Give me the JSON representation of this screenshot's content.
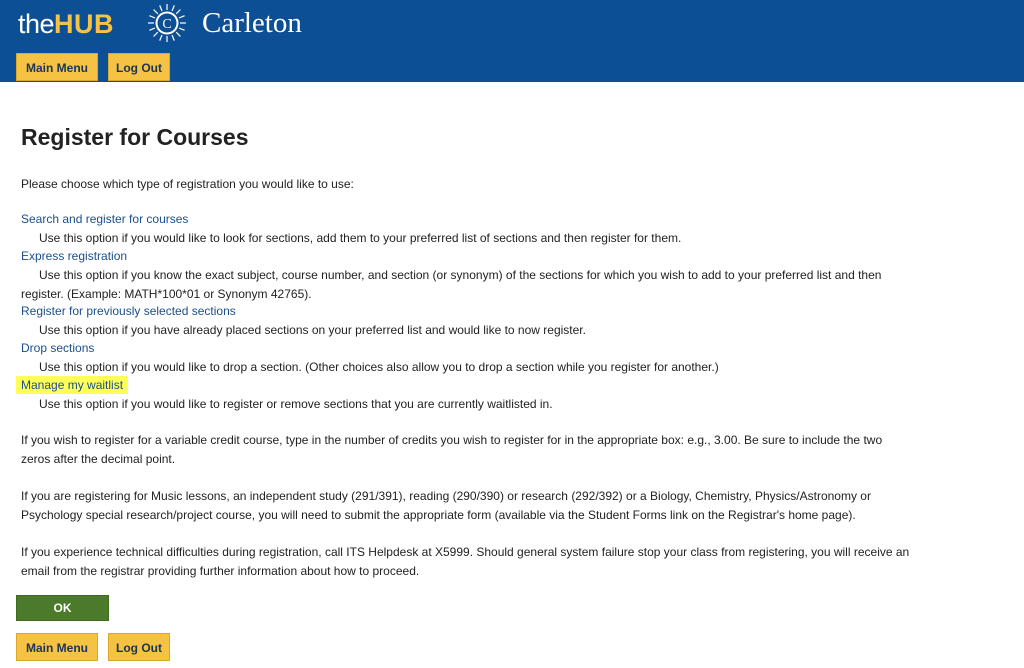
{
  "header": {
    "brand_the": "the",
    "brand_hub": "HUB",
    "seal_letter": "C",
    "institution": "Carleton",
    "main_menu_label": "Main Menu",
    "logout_label": "Log Out"
  },
  "page": {
    "title": "Register for Courses",
    "intro": "Please choose which type of registration you would like to use:"
  },
  "options": [
    {
      "label": "Search and register for courses",
      "desc": "Use this option if you would like to look for sections, add them to your preferred list of sections and then register for them."
    },
    {
      "label": "Express registration",
      "desc": "Use this option if you know the exact subject, course number, and section (or synonym) of the sections for which you wish to add to your preferred list and then register. (Example: MATH*100*01 or Synonym 42765)."
    },
    {
      "label": "Register for previously selected sections",
      "desc": "Use this option if you have already placed sections on your preferred list and would like to now register."
    },
    {
      "label": "Drop sections",
      "desc": "Use this option if you would like to drop a section. (Other choices also allow you to drop a section while you register for another.)"
    },
    {
      "label": "Manage my waitlist",
      "desc": "Use this option if you would like to register or remove sections that you are currently waitlisted in."
    }
  ],
  "notes": {
    "variable_credit": "If you wish to register for a variable credit course, type in the number of credits you wish to register for in the appropriate box: e.g., 3.00. Be sure to include the two zeros after the decimal point.",
    "music": "If you are registering for Music lessons, an independent study (291/391), reading (290/390) or research (292/392) or a Biology, Chemistry, Physics/Astronomy or Psychology special research/project course, you will need to submit the appropriate form (available via the Student Forms link on the Registrar's home page).",
    "technical": "If you experience technical difficulties during registration, call ITS Helpdesk at X5999. Should general system failure stop your class from registering, you will receive an email from the registrar providing further information about how to proceed."
  },
  "footer": {
    "ok_label": "OK",
    "main_menu_label": "Main Menu",
    "logout_label": "Log Out"
  },
  "colors": {
    "header_bg": "#0c4f95",
    "accent_gold": "#f6c243",
    "link": "#1b4f8c",
    "highlight": "#ffff5a",
    "ok_green": "#4a7a2a"
  }
}
